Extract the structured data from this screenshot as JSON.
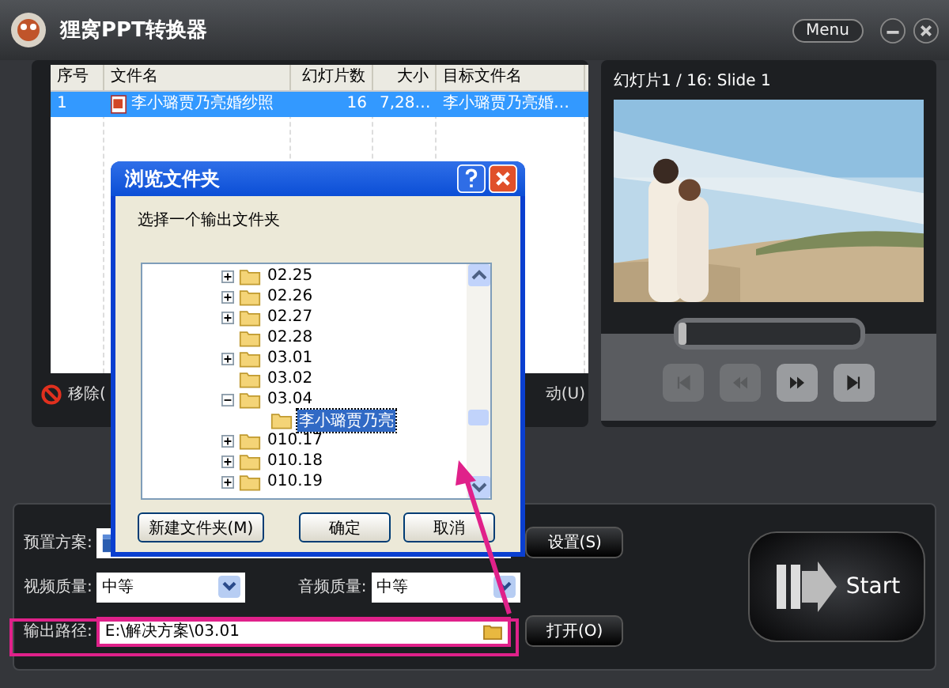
{
  "window": {
    "title": "狸窝PPT转换器",
    "menu_button": "Menu"
  },
  "table": {
    "columns": [
      "序号",
      "文件名",
      "幻灯片数",
      "大小",
      "目标文件名"
    ],
    "rows": [
      {
        "index": "1",
        "file": "李小璐贾乃亮婚纱照",
        "slides": "16",
        "size": "7,28…",
        "target": "李小璐贾乃亮婚…",
        "selected": true
      }
    ]
  },
  "list_actions": {
    "remove": "移除(",
    "move": "动(U)"
  },
  "preview": {
    "caption": "幻灯片1 / 16: Slide 1",
    "position": {
      "level": 0
    },
    "controls": [
      {
        "kind": "first",
        "disabled": true
      },
      {
        "kind": "rewind",
        "disabled": true
      },
      {
        "kind": "forward",
        "disabled": false
      },
      {
        "kind": "last",
        "disabled": false
      }
    ]
  },
  "settings": {
    "preset_label": "预置方案:",
    "settings_button": "设置(S)",
    "video_label": "视频质量:",
    "video_value": "中等",
    "audio_label": "音频质量:",
    "audio_value": "中等",
    "output_label": "输出路径:",
    "output_value": "E:\\解决方案\\03.01",
    "open_button": "打开(O)",
    "start_button": "Start"
  },
  "dialog": {
    "title": "浏览文件夹",
    "prompt": "选择一个输出文件夹",
    "tree": [
      {
        "label": "02.25",
        "expanded": false,
        "selected": false
      },
      {
        "label": "02.26",
        "expanded": false,
        "selected": false
      },
      {
        "label": "02.27",
        "expanded": false,
        "selected": false
      },
      {
        "label": "02.28",
        "selected": false
      },
      {
        "label": "03.01",
        "expanded": false,
        "selected": false
      },
      {
        "label": "03.02",
        "selected": false
      },
      {
        "label": "03.04",
        "expanded": true,
        "selected": false,
        "children": [
          {
            "label": "李小璐贾乃亮",
            "selected": true
          }
        ]
      },
      {
        "label": "010.17",
        "expanded": false,
        "selected": false
      },
      {
        "label": "010.18",
        "expanded": false,
        "selected": false
      },
      {
        "label": "010.19",
        "expanded": false,
        "selected": false
      }
    ],
    "buttons": [
      "新建文件夹(M)",
      "确定",
      "取消"
    ]
  }
}
